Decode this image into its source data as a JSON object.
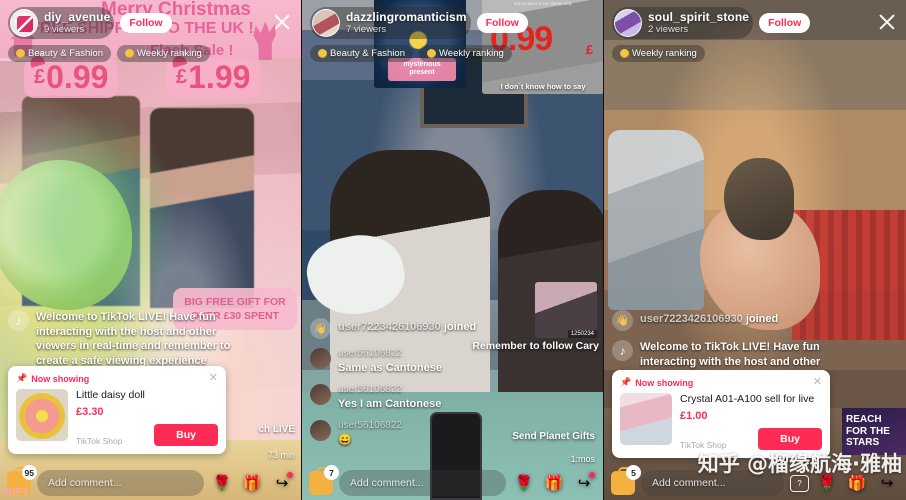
{
  "watermark": {
    "text": "知乎 @榴缘航海·雅柚"
  },
  "panels": [
    {
      "host": {
        "username": "diy_avenue",
        "viewers": "9 viewers",
        "follow_label": "Follow",
        "avatar": "diy-logo-avatar"
      },
      "close_label": "close-icon",
      "tags": [
        {
          "label": "Beauty & Fashion",
          "icon": "medal-icon"
        },
        {
          "label": "Weekly ranking",
          "icon": "medal-icon"
        }
      ],
      "overlays": {
        "title": "Merry Christmas",
        "subtitle": "FREE SHIPPING TO THE UK !",
        "flash": "Flash Sale  !",
        "price_stickers": [
          {
            "currency": "£",
            "value": "0.99"
          },
          {
            "currency": "£",
            "value": "1.99"
          }
        ],
        "gift_bubble": "BIG FREE GIFT FOR OVER £30 SPENT",
        "side_live": "ch LIVE",
        "side_min": "73 min",
        "corner_tag": "GIFT"
      },
      "chat": [
        {
          "type": "system",
          "avatar": "tiktok-music-icon",
          "message": "Welcome to TikTok LIVE! Have fun interacting with the host and other viewers in real-time and remember to create a safe viewing experience"
        }
      ],
      "product": {
        "now_showing": "Now showing",
        "title": "Little daisy doll",
        "price": "£3.30",
        "shop": "TikTok Shop",
        "buy_label": "Buy",
        "image": "daisy-plush-thumbnail"
      },
      "bottom": {
        "cart_badge": "95",
        "comment_placeholder": "Add comment...",
        "icons": [
          "rose-icon",
          "gift-icon",
          "share-icon"
        ]
      }
    },
    {
      "host": {
        "username": "dazzlingromanticism",
        "viewers": "7 viewers",
        "follow_label": "Follow",
        "avatar": "portrait-avatar"
      },
      "close_label": "close-icon",
      "tags": [
        {
          "label": "Beauty & Fashion",
          "icon": "medal-icon"
        },
        {
          "label": "Weekly ranking",
          "icon": "medal-icon"
        }
      ],
      "overlays": {
        "card_flower_label": "mysterious present",
        "card_cable_price": "0.99",
        "card_cable_currency": "£",
        "card_cable_caption": "I don´t know how to say",
        "card_cable_topcaption": "this product is for clients only",
        "pip_label": "1250234",
        "planet_gift": "Send Planet Gifts",
        "follow_cary": "Remember to follow Cary",
        "timer": "1:mos"
      },
      "chat": [
        {
          "type": "join",
          "avatar": "wave-icon",
          "user": "user7223426106930",
          "message": "joined"
        },
        {
          "type": "message",
          "avatar": "user-avatar",
          "user": "user56106822",
          "message": "Same as Cantonese"
        },
        {
          "type": "message",
          "avatar": "user-avatar",
          "user": "user56106822",
          "message": "Yes I am Cantonese"
        },
        {
          "type": "emoji",
          "avatar": "user-avatar",
          "user": "user56106822",
          "message": "😄"
        }
      ],
      "product": null,
      "bottom": {
        "cart_badge": "7",
        "comment_placeholder": "Add comment...",
        "icons": [
          "rose-icon",
          "gift-icon",
          "share-icon"
        ]
      }
    },
    {
      "host": {
        "username": "soul_spirit_stone",
        "viewers": "2 viewers",
        "follow_label": "Follow",
        "avatar": "crystal-avatar"
      },
      "close_label": "close-icon",
      "tags": [
        {
          "label": "Weekly ranking",
          "icon": "medal-icon"
        }
      ],
      "overlays": {
        "stars_banner": "REACH FOR THE STARS"
      },
      "chat": [
        {
          "type": "join",
          "avatar": "wave-icon",
          "user": "user7223426106930",
          "message": "joined"
        },
        {
          "type": "system",
          "avatar": "tiktok-music-icon",
          "message": "Welcome to TikTok LIVE! Have fun interacting with the host and other"
        }
      ],
      "product": {
        "now_showing": "Now showing",
        "title": "Crystal A01-A100 sell for live",
        "price": "£1.00",
        "shop": "TikTok Shop",
        "buy_label": "Buy",
        "image": "crystal-cluster-thumbnail"
      },
      "bottom": {
        "cart_badge": "5",
        "comment_placeholder": "Add comment...",
        "icons": [
          "message-icon",
          "rose-icon",
          "gift-icon",
          "share-icon"
        ]
      }
    }
  ],
  "colors": {
    "accent": "#fe2c55",
    "pink": "#e8629a",
    "gold": "#f3b13f"
  }
}
